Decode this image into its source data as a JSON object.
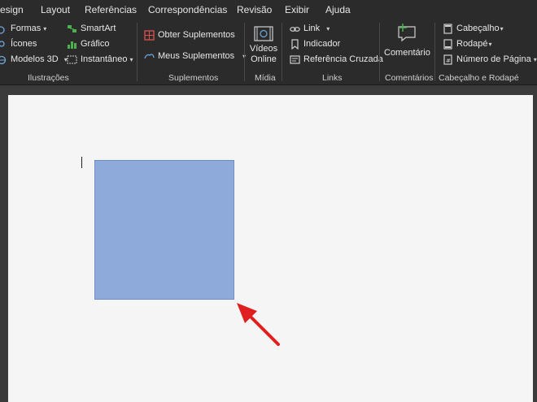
{
  "tabs": [
    "esign",
    "Layout",
    "Referências",
    "Correspondências",
    "Revisão",
    "Exibir",
    "Ajuda"
  ],
  "ribbon": {
    "ilustracoes": {
      "items": [
        "Formas",
        "Ícones",
        "Modelos 3D",
        "SmartArt",
        "Gráfico",
        "Instantâneo"
      ],
      "label": "Ilustrações"
    },
    "suplementos": {
      "items": [
        "Obter Suplementos",
        "Meus Suplementos"
      ],
      "label": "Suplementos"
    },
    "midia": {
      "button": "Vídeos Online",
      "button_line1": "Vídeos",
      "button_line2": "Online",
      "label": "Mídia"
    },
    "links": {
      "items": [
        "Link",
        "Indicador",
        "Referência Cruzada"
      ],
      "label": "Links"
    },
    "comentarios": {
      "button": "Comentário",
      "label": "Comentários"
    },
    "cabecalho": {
      "items": [
        "Cabeçalho",
        "Rodapé",
        "Número de Página"
      ],
      "label": "Cabeçalho e Rodapé"
    }
  },
  "colors": {
    "ribbon_bg": "#2b2b2b",
    "page_bg": "#f5f5f5",
    "shape_fill": "#8eaadb",
    "arrow": "#e02020"
  },
  "icons": [
    "shapes-icon",
    "icons-icon",
    "3d-models-icon",
    "smartart-icon",
    "chart-icon",
    "screenshot-icon",
    "store-icon",
    "my-addins-icon",
    "online-video-icon",
    "link-icon",
    "bookmark-icon",
    "cross-reference-icon",
    "comment-icon",
    "header-icon",
    "footer-icon",
    "page-number-icon",
    "red-arrow-icon"
  ]
}
